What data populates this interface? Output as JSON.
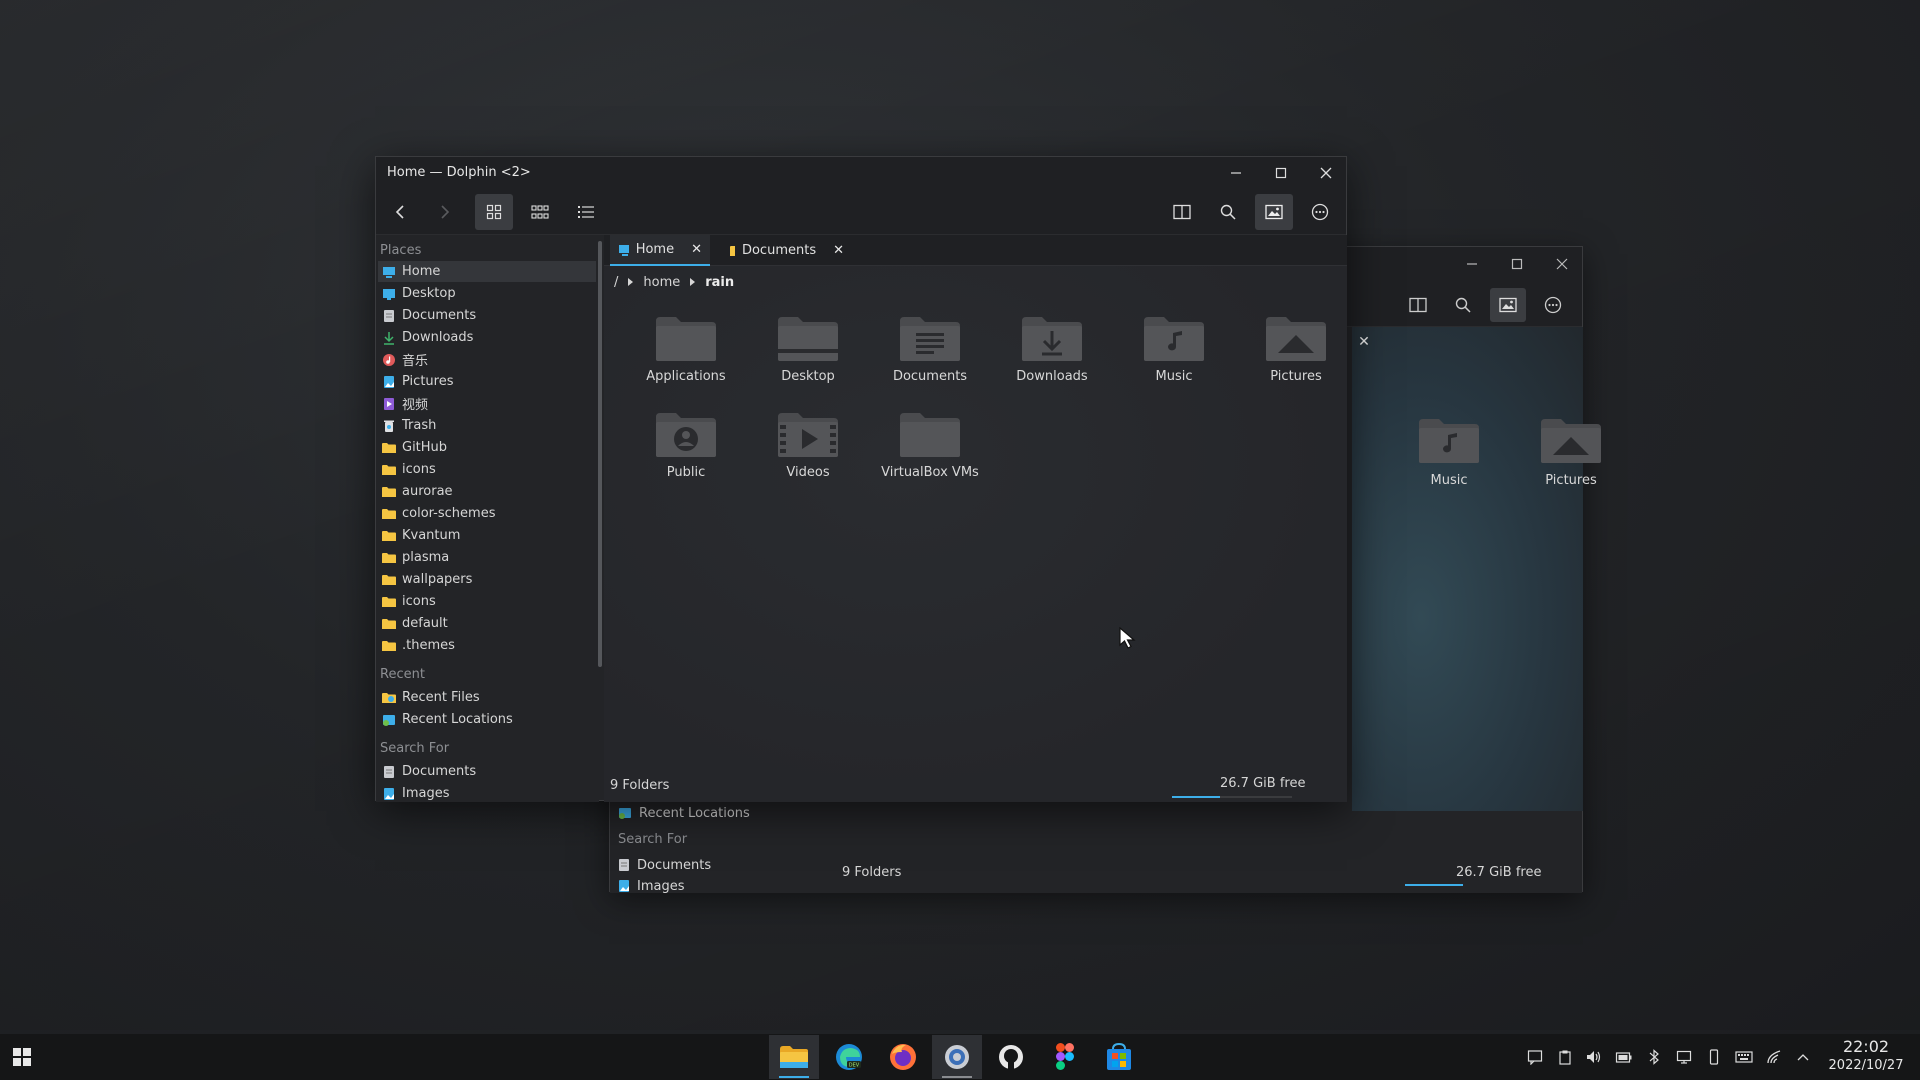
{
  "front_window": {
    "title": "Home — Dolphin <2>",
    "tabs": [
      {
        "label": "Home",
        "active": true
      },
      {
        "label": "Documents",
        "active": false
      }
    ],
    "breadcrumb": {
      "root": "/",
      "parts": [
        "home",
        "rain"
      ]
    },
    "places": {
      "section_places": "Places",
      "items": [
        "Home",
        "Desktop",
        "Documents",
        "Downloads",
        "音乐",
        "Pictures",
        "视频",
        "Trash",
        "GitHub",
        "icons",
        "aurorae",
        "color-schemes",
        "Kvantum",
        "plasma",
        "wallpapers",
        "icons",
        "default",
        ".themes"
      ],
      "section_recent": "Recent",
      "recent": [
        "Recent Files",
        "Recent Locations"
      ],
      "section_search": "Search For",
      "search": [
        "Documents",
        "Images"
      ]
    },
    "folders": [
      "Applications",
      "Desktop",
      "Documents",
      "Downloads",
      "Music",
      "Pictures",
      "Public",
      "Videos",
      "VirtualBox VMs"
    ],
    "status": {
      "count": "9 Folders",
      "free": "26.7 GiB free",
      "used_fraction": 0.4
    }
  },
  "back_window": {
    "folders": [
      "Music",
      "Pictures"
    ],
    "places_recent": "Recent Locations",
    "section_search": "Search For",
    "search": [
      "Documents",
      "Images"
    ],
    "status": {
      "count": "9 Folders",
      "free": "26.7 GiB free"
    }
  },
  "taskbar": {
    "apps": [
      "file-manager",
      "edge-dev",
      "firefox",
      "settings",
      "github-desktop",
      "figma",
      "store"
    ],
    "clock": {
      "time": "22:02",
      "date": "2022/10/27"
    }
  },
  "colors": {
    "accent": "#3daee9",
    "folder": "#4a4b4e"
  }
}
